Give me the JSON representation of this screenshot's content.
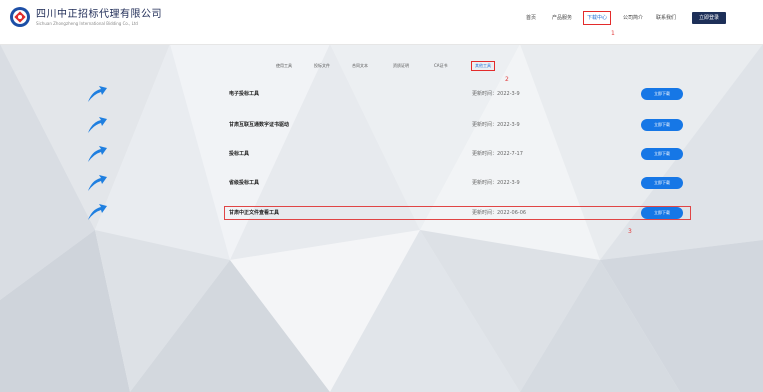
{
  "header": {
    "company_cn": "四川中正招标代理有限公司",
    "company_en": "Sichuan Zhongzheng International Bidding Co., Ltd",
    "nav": [
      {
        "label": "首页",
        "active": false
      },
      {
        "label": "产品服务",
        "active": false
      },
      {
        "label": "下载中心",
        "active": true
      },
      {
        "label": "公司简介",
        "active": false
      },
      {
        "label": "联系我们",
        "active": false
      }
    ],
    "cta_label": "立即登录",
    "marker_1": "1"
  },
  "tabs": {
    "items": [
      {
        "label": "使用工具",
        "active": false
      },
      {
        "label": "投标文件",
        "active": false
      },
      {
        "label": "合同文本",
        "active": false
      },
      {
        "label": "资质证明",
        "active": false
      },
      {
        "label": "CA证书",
        "active": false
      },
      {
        "label": "其他工具",
        "active": true
      }
    ],
    "marker_2": "2"
  },
  "downloads": [
    {
      "title": "电子投标工具",
      "update": "更新时间：2022-3-9",
      "button": "立即下载"
    },
    {
      "title": "甘肃互联互通数字证书驱动",
      "update": "更新时间：2022-3-9",
      "button": "立即下载"
    },
    {
      "title": "投标工具",
      "update": "更新时间：2022-7-17",
      "button": "立即下载"
    },
    {
      "title": "省级投标工具",
      "update": "更新时间：2022-3-9",
      "button": "立即下载"
    },
    {
      "title": "甘肃中正文件查看工具",
      "update": "更新时间：2022-06-06",
      "button": "立即下载"
    }
  ],
  "marker_3": "3",
  "colors": {
    "accent": "#1677e6",
    "highlight": "#e04545",
    "dark_nav": "#1d2f58"
  },
  "icons": {
    "row_icon": "arrow-icon",
    "logo": "logo-icon"
  }
}
